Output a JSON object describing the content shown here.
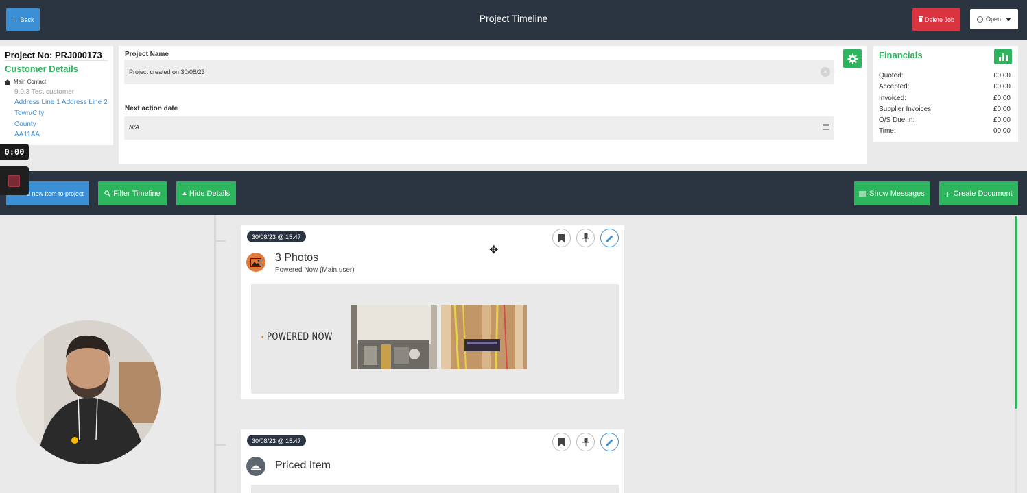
{
  "header": {
    "title": "Project Timeline",
    "back_label": "Back",
    "delete_label": "Delete Job",
    "status_label": "Open"
  },
  "customer": {
    "project_no": "Project No: PRJ000173",
    "section_title": "Customer Details",
    "contact_label": "Main Contact",
    "name": "9.0.3 Test customer",
    "address_line": "Address Line 1 Address Line 2",
    "town": "Town/City",
    "county": "County",
    "postcode": "AA11AA"
  },
  "timer": {
    "display": "0:00"
  },
  "project": {
    "name_label": "Project Name",
    "name_value": "Project created on 30/08/23",
    "next_action_label": "Next action date",
    "next_action_value": "N/A"
  },
  "financials": {
    "title": "Financials",
    "rows": [
      {
        "label": "Quoted:",
        "value": "£0.00"
      },
      {
        "label": "Accepted:",
        "value": "£0.00"
      },
      {
        "label": "Invoiced:",
        "value": "£0.00"
      },
      {
        "label": "Supplier Invoices:",
        "value": "£0.00"
      },
      {
        "label": "O/S Due In:",
        "value": "£0.00"
      },
      {
        "label": "Time:",
        "value": "00:00"
      }
    ]
  },
  "actions": {
    "add_item": "d new item to project",
    "filter": "Filter Timeline",
    "hide": "Hide Details",
    "messages": "Show Messages",
    "create": "Create Document"
  },
  "timeline": [
    {
      "date": "30/08/23 @ 15:47",
      "title": "3 Photos",
      "subtitle": "Powered Now (Main user)",
      "logo_text": "POWERED NOW",
      "icon": "photo-icon",
      "icon_color": "#e07a3a"
    },
    {
      "date": "30/08/23 @ 15:47",
      "title": "Priced Item",
      "icon": "priced-item-icon",
      "icon_color": "#5d6670"
    }
  ],
  "colors": {
    "header_bg": "#2b3542",
    "accent_green": "#2db55d",
    "accent_blue": "#3b8fd4",
    "danger_red": "#d9343f"
  }
}
